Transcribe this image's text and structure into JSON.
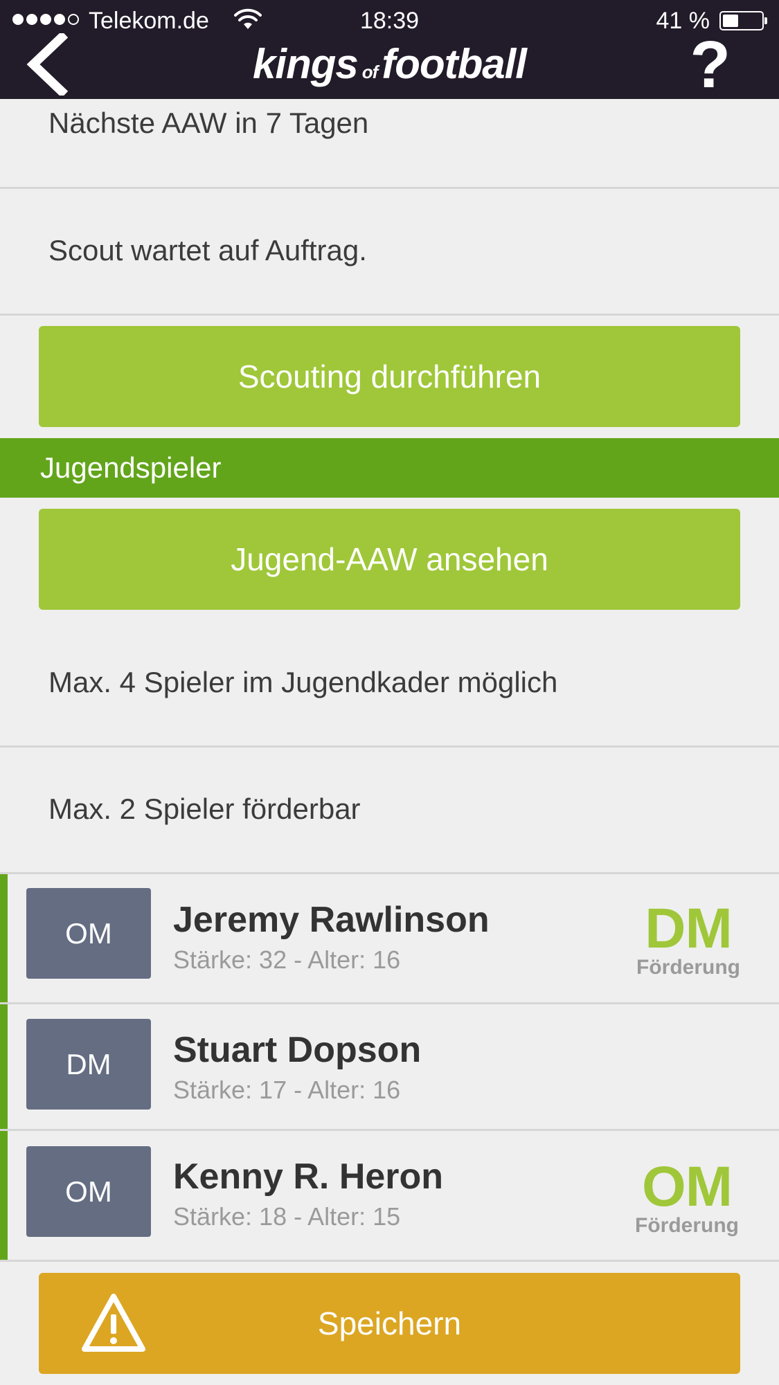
{
  "status_bar": {
    "carrier": "Telekom.de",
    "time": "18:39",
    "battery_text": "41 %",
    "battery_level": 0.41,
    "signal_bars": 4,
    "signal_max": 5
  },
  "nav": {
    "back_icon": "chevron-left-icon",
    "logo_part1": "kings",
    "logo_of": "of",
    "logo_part2": "football",
    "help_label": "?"
  },
  "scout": {
    "next_aaw": "Nächste AAW in 7 Tagen",
    "status": "Scout wartet auf Auftrag.",
    "button_label": "Scouting durchführen"
  },
  "youth": {
    "section_title": "Jugendspieler",
    "aaw_button_label": "Jugend-AAW ansehen",
    "max_squad": "Max. 4 Spieler im Jugendkader möglich",
    "max_promotable": "Max. 2 Spieler förderbar",
    "players": [
      {
        "position": "OM",
        "name": "Jeremy Rawlinson",
        "details": "Stärke: 32 - Alter: 16",
        "promotion_position": "DM",
        "promotion_label": "Förderung"
      },
      {
        "position": "DM",
        "name": "Stuart Dopson",
        "details": "Stärke: 17 - Alter: 16",
        "promotion_position": null,
        "promotion_label": null
      },
      {
        "position": "OM",
        "name": "Kenny R. Heron",
        "details": "Stärke: 18 - Alter: 15",
        "promotion_position": "OM",
        "promotion_label": "Förderung"
      }
    ]
  },
  "save": {
    "label": "Speichern",
    "icon": "warning-icon"
  },
  "colors": {
    "nav_background": "#221b29",
    "button_green": "#9fc739",
    "section_green": "#62a51b",
    "position_badge": "#646d82",
    "save_gold": "#dca623",
    "page_background": "#efefef"
  }
}
